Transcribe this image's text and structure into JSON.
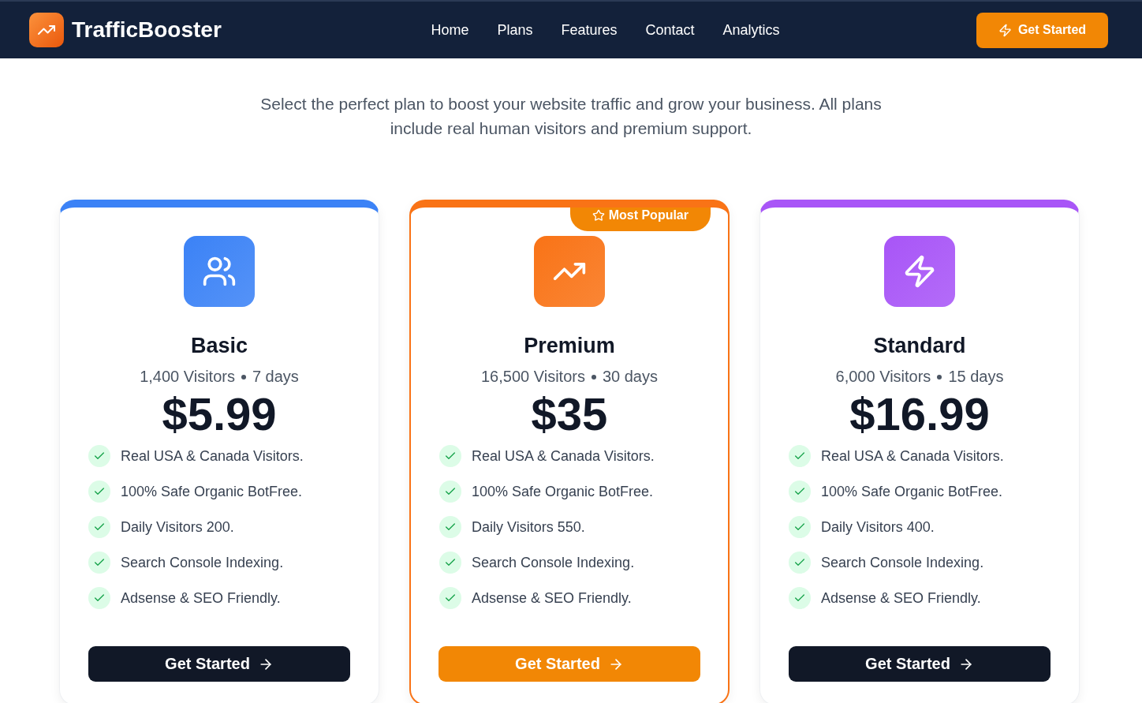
{
  "navbar": {
    "brand": "TrafficBooster",
    "links": [
      {
        "label": "Home"
      },
      {
        "label": "Plans"
      },
      {
        "label": "Features"
      },
      {
        "label": "Contact"
      },
      {
        "label": "Analytics"
      }
    ],
    "cta": "Get Started"
  },
  "subtitle": "Select the perfect plan to boost your website traffic and grow your business. All plans include real human visitors and premium support.",
  "plans": [
    {
      "name": "Basic",
      "kind": "users",
      "color": "#3b82f6",
      "featured": false,
      "visitors": "1,400 Visitors",
      "duration": "7 days",
      "price": "$5.99",
      "features": [
        "Real USA & Canada Visitors.",
        "100% Safe Organic BotFree.",
        "Daily Visitors 200.",
        "Search Console Indexing.",
        "Adsense & SEO Friendly."
      ],
      "button": "Get Started"
    },
    {
      "name": "Premium",
      "kind": "trend",
      "color": "#f97316",
      "featured": true,
      "badge": "Most Popular",
      "visitors": "16,500 Visitors",
      "duration": "30 days",
      "price": "$35",
      "features": [
        "Real USA & Canada Visitors.",
        "100% Safe Organic BotFree.",
        "Daily Visitors 550.",
        "Search Console Indexing.",
        "Adsense & SEO Friendly."
      ],
      "button": "Get Started"
    },
    {
      "name": "Standard",
      "kind": "zap",
      "color": "#a855f7",
      "featured": false,
      "visitors": "6,000 Visitors",
      "duration": "15 days",
      "price": "$16.99",
      "features": [
        "Real USA & Canada Visitors.",
        "100% Safe Organic BotFree.",
        "Daily Visitors 400.",
        "Search Console Indexing.",
        "Adsense & SEO Friendly."
      ],
      "button": "Get Started"
    }
  ]
}
